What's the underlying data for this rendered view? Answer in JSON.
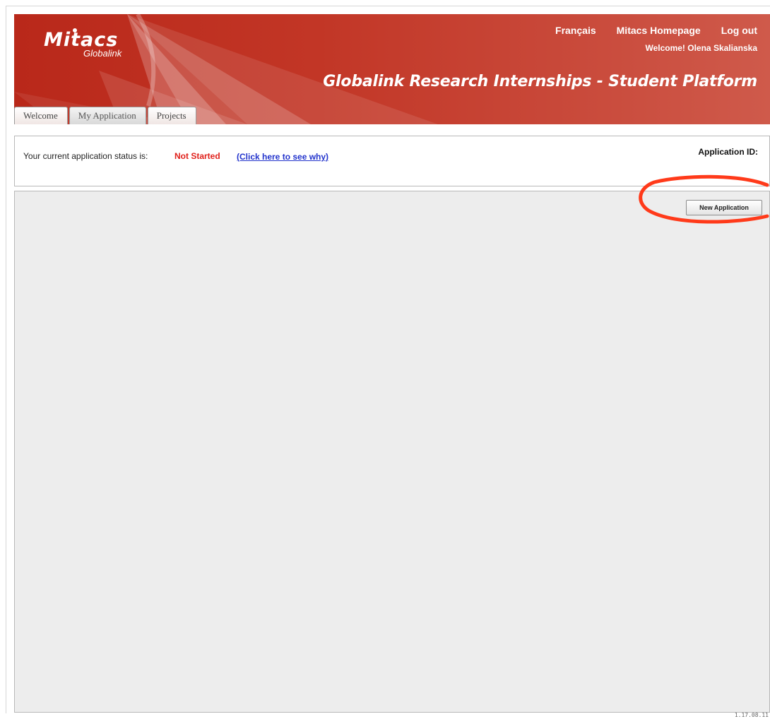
{
  "header": {
    "logo_main": "Mitacs",
    "logo_sub": "Globalink",
    "links": [
      {
        "label": "Français"
      },
      {
        "label": "Mitacs Homepage"
      },
      {
        "label": "Log out"
      }
    ],
    "welcome": "Welcome! Olena Skalianska",
    "platform_title": "Globalink Research Internships - Student Platform"
  },
  "tabs": [
    {
      "label": "Welcome",
      "active": false
    },
    {
      "label": "My Application",
      "active": true
    },
    {
      "label": "Projects",
      "active": false
    }
  ],
  "status": {
    "prefix": "Your current application status is:",
    "value": "Not Started",
    "why_link": "(Click here to see why)",
    "application_id_label": "Application ID:"
  },
  "main": {
    "new_application_button": "New Application"
  },
  "footer": {
    "version": "1.17.08.11"
  },
  "colors": {
    "banner_red": "#b9281a",
    "status_red": "#e0211b",
    "link_blue": "#2233cc",
    "panel_gray": "#ededed",
    "annotation_red": "#ff3a1a"
  }
}
